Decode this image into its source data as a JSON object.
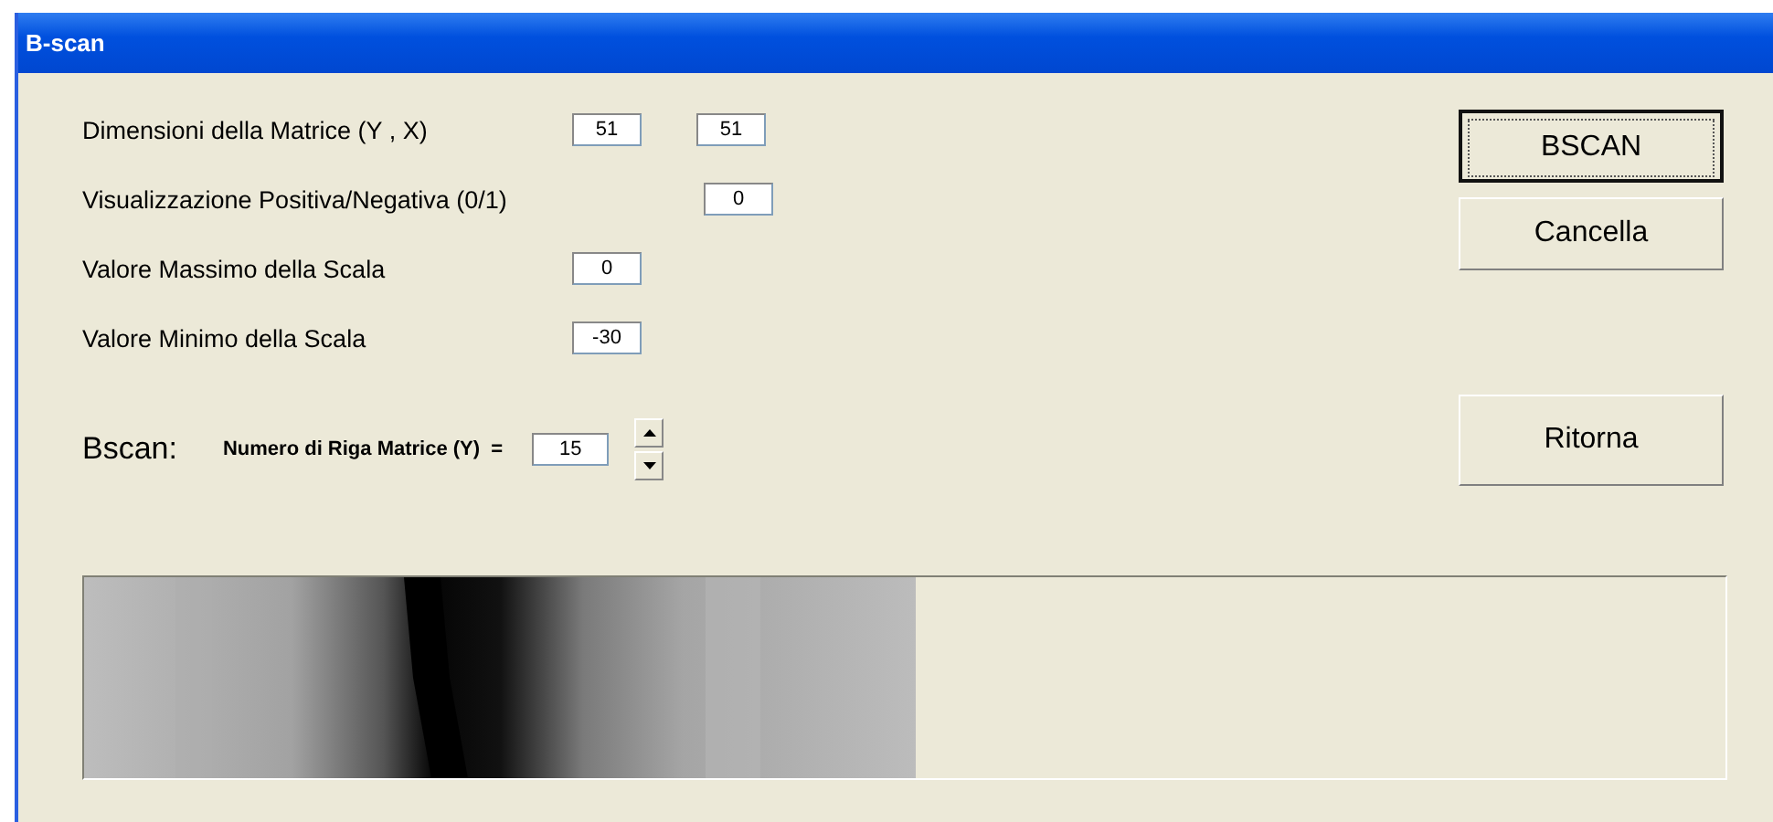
{
  "window": {
    "title": "B-scan"
  },
  "fields": [
    {
      "label": "Dimensioni della Matrice (Y , X)",
      "values": [
        "51",
        "51"
      ]
    },
    {
      "label": "Visualizzazione Positiva/Negativa (0/1)",
      "values": [
        "0"
      ]
    },
    {
      "label": "Valore Massimo della Scala",
      "values": [
        "0"
      ]
    },
    {
      "label": "Valore Minimo della Scala",
      "values": [
        "-30"
      ]
    }
  ],
  "bscan": {
    "heading": "Bscan:",
    "label": "Numero di Riga Matrice (Y)  =",
    "value": "15"
  },
  "buttons": [
    {
      "label": "BSCAN",
      "default": true
    },
    {
      "label": "Cancella",
      "default": false
    },
    {
      "label": "Ritorna",
      "default": false
    }
  ]
}
